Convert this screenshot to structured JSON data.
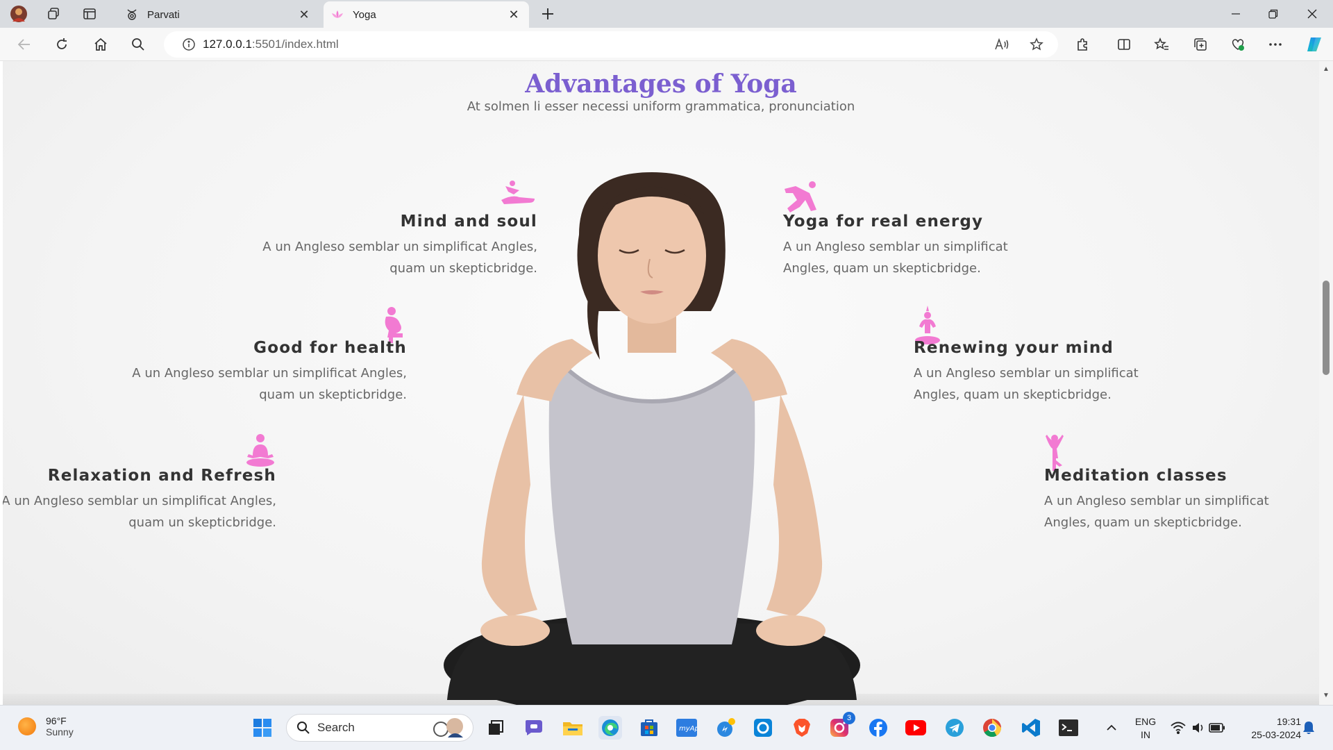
{
  "browser": {
    "tabs": [
      {
        "title": "Parvati",
        "active": false
      },
      {
        "title": "Yoga",
        "active": true
      }
    ],
    "url_host": "127.0.0.1",
    "url_rest": ":5501/index.html"
  },
  "page": {
    "title": "Advantages of Yoga",
    "subtitle": "At solmen li esser necessi uniform grammatica, pronunciation",
    "features": [
      {
        "title": "Mind and soul",
        "text": "A un Angleso semblar un simplificat Angles, quam un skepticbridge.",
        "icon": "mind-soul-icon"
      },
      {
        "title": "Yoga for real energy",
        "text": "A un Angleso semblar un simplificat Angles, quam un skepticbridge.",
        "icon": "energy-icon"
      },
      {
        "title": "Good for health",
        "text": "A un Angleso semblar un simplificat Angles, quam un skepticbridge.",
        "icon": "health-icon"
      },
      {
        "title": "Renewing your mind",
        "text": "A un Angleso semblar un simplificat Angles, quam un skepticbridge.",
        "icon": "renew-mind-icon"
      },
      {
        "title": "Relaxation and Refresh",
        "text": "A un Angleso semblar un simplificat Angles, quam un skepticbridge.",
        "icon": "relaxation-icon"
      },
      {
        "title": "Meditation classes",
        "text": "A un Angleso semblar un simplificat Angles, quam un skepticbridge.",
        "icon": "meditation-icon"
      }
    ],
    "accent_color": "#f27ad2",
    "title_color": "#7b5fd0"
  },
  "taskbar": {
    "weather_temp": "96°F",
    "weather_desc": "Sunny",
    "search_label": "Search",
    "instagram_badge": "3",
    "lang_line1": "ENG",
    "lang_line2": "IN",
    "time": "19:31",
    "date": "25-03-2024"
  }
}
